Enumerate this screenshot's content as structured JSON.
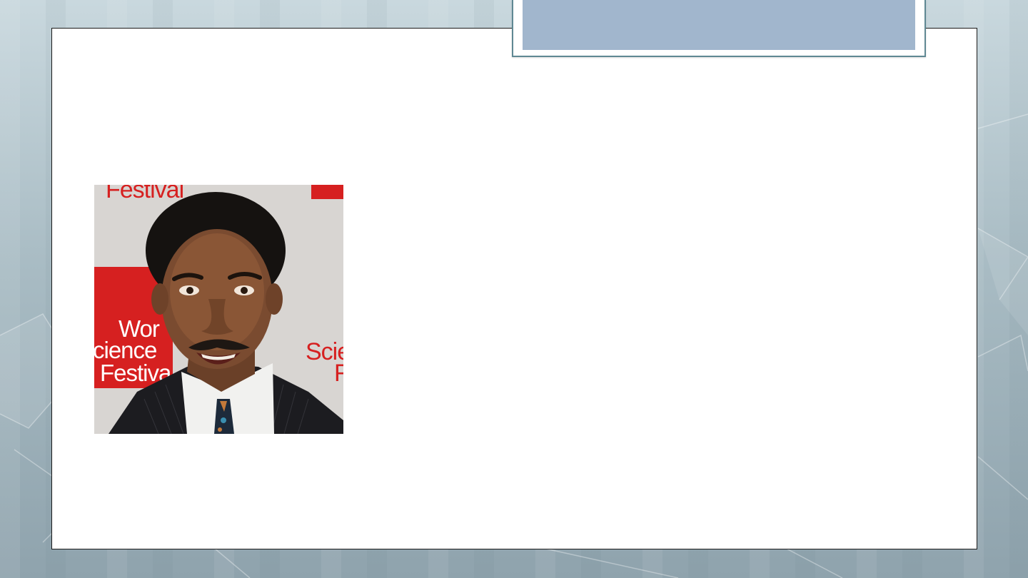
{
  "slide": {
    "title": "",
    "photo": {
      "backdrop_text": {
        "top": "Festival",
        "left_line1": "Wor",
        "left_line2": "cience",
        "left_line3": "Festiva",
        "right_line1": "Scie",
        "right_line2": "F"
      }
    }
  },
  "colors": {
    "title_fill": "#a1b6cd",
    "title_border": "#5f8893",
    "backdrop_red": "#d62020"
  }
}
